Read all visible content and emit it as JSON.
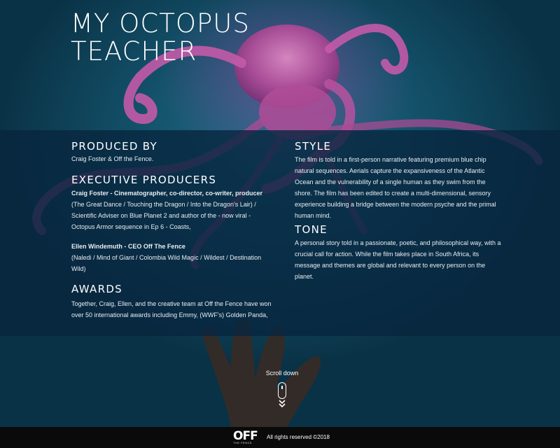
{
  "title": "MY OCTOPUS TEACHER",
  "produced": {
    "heading": "PRODUCED BY",
    "text": "Craig Foster & Off the Fence."
  },
  "exec": {
    "heading": "EXECUTIVE PRODUCERS",
    "person1_name": "Craig Foster - Cinematographer, co-director, co-writer, producer",
    "person1_bio": "(The Great Dance / Touching the Dragon / Into the Dragon's Lair) / Scientific Adviser on Blue Planet 2 and author of the - now viral - Octopus Armor sequence in Ep 6 - Coasts,",
    "person2_name": "Ellen Windemuth - CEO Off The Fence",
    "person2_bio": "(Naledi / Mind of Giant / Colombia Wild Magic / Wildest / Destination Wild)"
  },
  "awards": {
    "heading": "AWARDS",
    "text": "Together, Craig, Ellen, and the creative team at Off the Fence have won over 50 international awards including Emmy, (WWF's) Golden Panda,"
  },
  "style": {
    "heading": "STYLE",
    "text": "The film is told in a first-person narrative featuring premium blue chip natural sequences. Aerials capture the expansiveness of the Atlantic Ocean and the vulnerability of a single human as they swim from the shore. The film has been edited to create a multi-dimensional, sensory experience building a bridge between the modern psyche and the primal human mind."
  },
  "tone": {
    "heading": "TONE",
    "text": "A personal story told in a passionate, poetic, and philosophical way, with a crucial call for action. While the film takes place in South Africa, its message and themes are global and relevant to every person on the planet."
  },
  "scroll": {
    "label": "Scroll down",
    "icon": "mouse-scroll-icon"
  },
  "footer": {
    "logo_text": "OFF",
    "logo_sub": "THE FENCE",
    "copyright": "All rights reserved ©2018"
  },
  "colors": {
    "panel": "#08263e",
    "octopus": "#c45aa8",
    "footer": "#0a0a0a"
  }
}
